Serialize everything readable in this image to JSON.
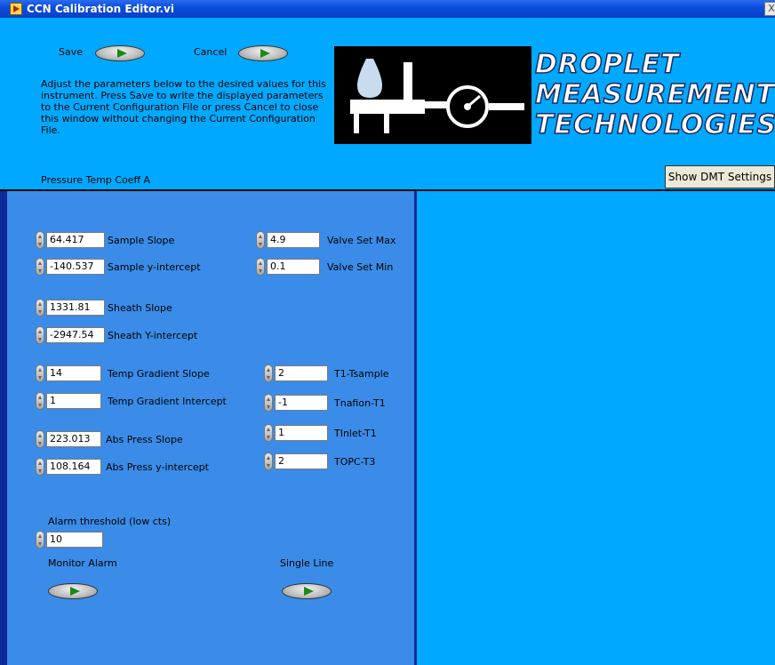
{
  "window": {
    "title": "CCN Calibration Editor.vi",
    "close_glyph": "X"
  },
  "header": {
    "save_label": "Save",
    "cancel_label": "Cancel",
    "instructions": "Adjust the parameters below to the desired values for this instrument.  Press Save to write the displayed parameters to the Current Configuration File or press Cancel to close this window without changing the Current Configuration File.",
    "status_label": "Pressure Temp Coeff A",
    "show_dmt_label": "Show DMT Settings"
  },
  "logo": {
    "lines": [
      "DROPLET",
      "MEASUREMENT",
      "TECHNOLOGIES"
    ]
  },
  "params": {
    "sample_slope": {
      "value": "64.417",
      "label": "Sample Slope"
    },
    "sample_intercept": {
      "value": "-140.537",
      "label": "Sample y-intercept"
    },
    "sheath_slope": {
      "value": "1331.81",
      "label": "Sheath Slope"
    },
    "sheath_intercept": {
      "value": "-2947.54",
      "label": "Sheath Y-intercept"
    },
    "temp_gradient_slope": {
      "value": "14",
      "label": "Temp Gradient Slope"
    },
    "temp_gradient_intercept": {
      "value": "1",
      "label": "Temp Gradient Intercept"
    },
    "abs_press_slope": {
      "value": "223.013",
      "label": "Abs Press Slope"
    },
    "abs_press_intercept": {
      "value": "108.164",
      "label": "Abs Press y-intercept"
    },
    "valve_set_max": {
      "value": "4.9",
      "label": "Valve Set Max"
    },
    "valve_set_min": {
      "value": "0.1",
      "label": "Valve Set Min"
    },
    "t1_tsample": {
      "value": "2",
      "label": "T1-Tsample"
    },
    "tnafion_t1": {
      "value": "-1",
      "label": "Tnafion-T1"
    },
    "tinlet_t1": {
      "value": "1",
      "label": "TInlet-T1"
    },
    "topc_t3": {
      "value": "2",
      "label": "TOPC-T3"
    },
    "alarm_threshold": {
      "value": "10",
      "label": "Alarm threshold (low cts)"
    }
  },
  "switches": {
    "monitor_alarm_label": "Monitor Alarm",
    "single_line_label": "Single Line"
  }
}
